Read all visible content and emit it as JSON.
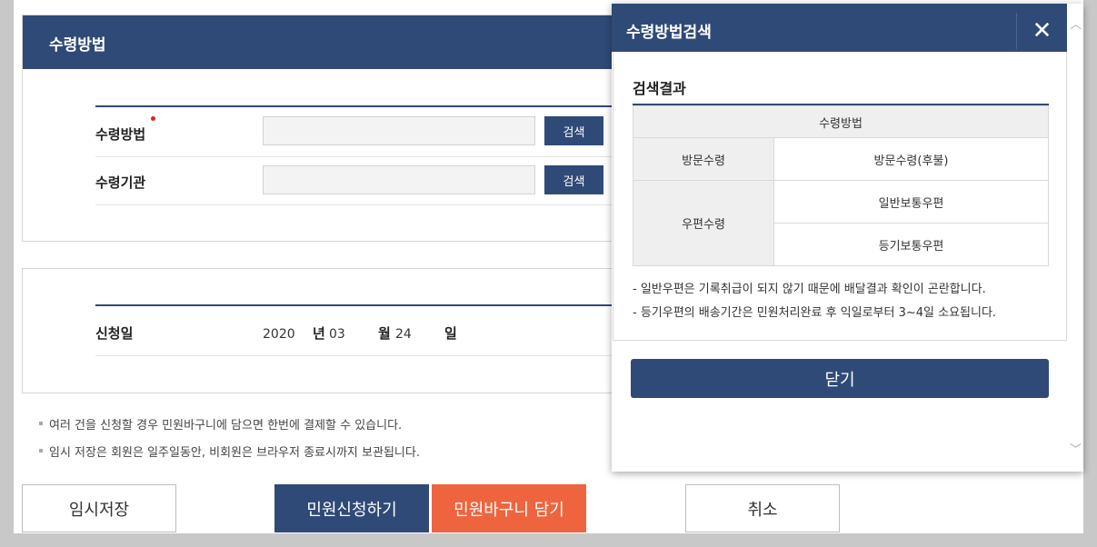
{
  "receive_section": {
    "title": "수령방법",
    "method_label": "수령방법",
    "agency_label": "수령기관",
    "method_value": "",
    "agency_value": "",
    "search_label": "검색"
  },
  "date_section": {
    "label": "신청일",
    "year": "2020",
    "year_unit": "년",
    "month": "03",
    "month_unit": "월",
    "day": "24",
    "day_unit": "일"
  },
  "notes": [
    "여러 건을 신청할 경우 민원바구니에 담으면 한번에 결제할 수 있습니다.",
    "임시 저장은 회원은 일주일동안, 비회원은 브라우저 종료시까지 보관됩니다."
  ],
  "buttons": {
    "temp_save": "임시저장",
    "apply": "민원신청하기",
    "basket": "민원바구니 담기",
    "cancel": "취소"
  },
  "modal": {
    "title": "수령방법검색",
    "close_glyph": "✕",
    "result_title": "검색결과",
    "table_header": "수령방법",
    "groups": [
      {
        "name": "방문수령",
        "items": [
          "방문수령(후불)"
        ]
      },
      {
        "name": "우편수령",
        "items": [
          "일반보통우편",
          "등기보통우편"
        ]
      }
    ],
    "notes": [
      "- 일반우편은 기록취급이 되지 않기 때문에 배달결과 확인이 곤란합니다.",
      "- 등기우편의 배송기간은 민원처리완료 후 익일로부터 3~4일 소요됩니다."
    ],
    "close_button": "닫기"
  },
  "colors": {
    "navy": "#304a78",
    "orange": "#ee643f",
    "required": "#e02020"
  }
}
